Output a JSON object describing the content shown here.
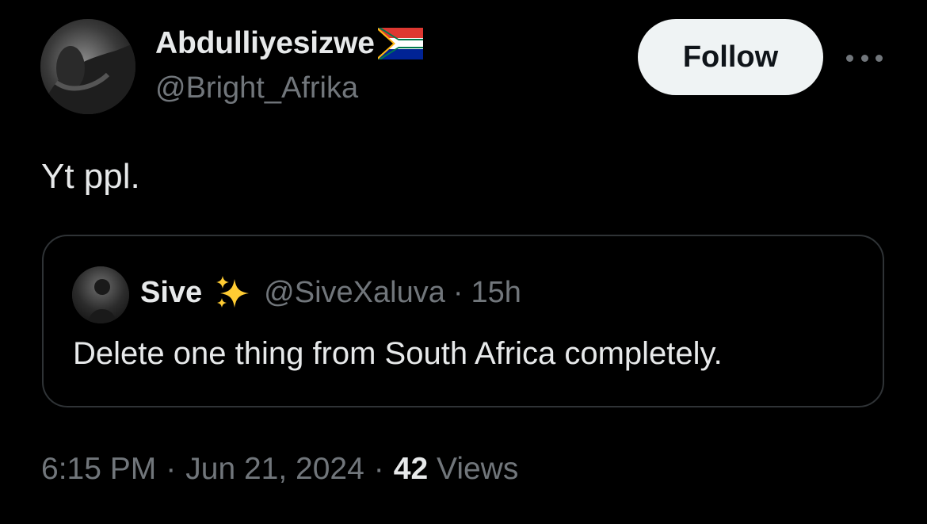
{
  "author": {
    "display_name": "Abdulliyesizwe",
    "handle": "@Bright_Afrika",
    "flag_icon": "south-africa-flag-icon"
  },
  "follow_button": {
    "label": "Follow"
  },
  "more_icon": "more-horizontal-icon",
  "tweet": {
    "text": "Yt ppl."
  },
  "quoted_tweet": {
    "display_name": "Sive",
    "emoji_icon": "sparkles-icon",
    "handle": "@SiveXaluva",
    "separator": "·",
    "time": "15h",
    "text": "Delete one thing from South Africa completely."
  },
  "meta": {
    "time": "6:15 PM",
    "separator1": "·",
    "date": "Jun 21, 2024",
    "separator2": "·",
    "views_count": "42",
    "views_label": "Views"
  },
  "colors": {
    "background": "#000000",
    "primary_text": "#e7e9ea",
    "secondary_text": "#71767b",
    "border": "#2f3336",
    "follow_bg": "#eff3f4",
    "follow_text": "#0f1419"
  }
}
